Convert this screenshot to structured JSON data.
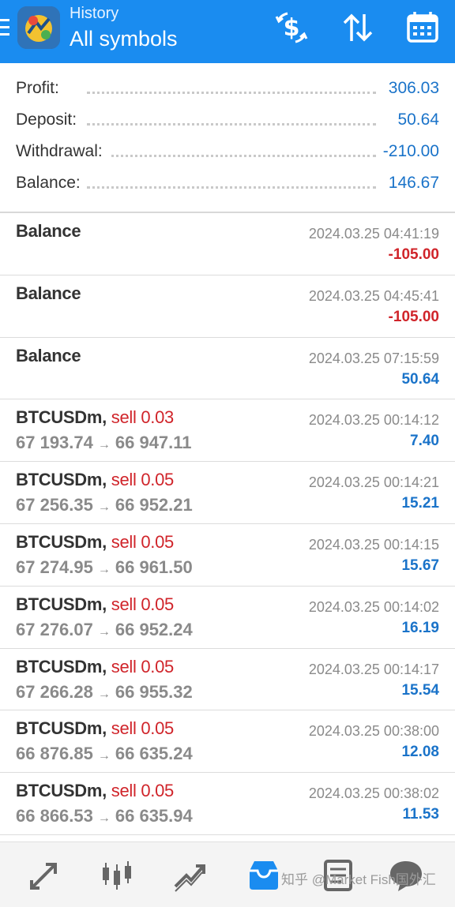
{
  "header": {
    "subtitle": "History",
    "title": "All symbols"
  },
  "summary": [
    {
      "label": "Profit:",
      "value": "306.03"
    },
    {
      "label": "Deposit:",
      "value": "50.64"
    },
    {
      "label": "Withdrawal:",
      "value": "-210.00"
    },
    {
      "label": "Balance:",
      "value": "146.67"
    }
  ],
  "items": [
    {
      "type": "balance",
      "title": "Balance",
      "date": "2024.03.25 04:41:19",
      "amount": "-105.00",
      "sign": "neg"
    },
    {
      "type": "balance",
      "title": "Balance",
      "date": "2024.03.25 04:45:41",
      "amount": "-105.00",
      "sign": "neg"
    },
    {
      "type": "balance",
      "title": "Balance",
      "date": "2024.03.25 07:15:59",
      "amount": "50.64",
      "sign": "pos"
    },
    {
      "type": "trade",
      "symbol": "BTCUSDm,",
      "side": "sell 0.03",
      "open": "67 193.74",
      "close": "66 947.11",
      "date": "2024.03.25 00:14:12",
      "amount": "7.40",
      "sign": "pos"
    },
    {
      "type": "trade",
      "symbol": "BTCUSDm,",
      "side": "sell 0.05",
      "open": "67 256.35",
      "close": "66 952.21",
      "date": "2024.03.25 00:14:21",
      "amount": "15.21",
      "sign": "pos"
    },
    {
      "type": "trade",
      "symbol": "BTCUSDm,",
      "side": "sell 0.05",
      "open": "67 274.95",
      "close": "66 961.50",
      "date": "2024.03.25 00:14:15",
      "amount": "15.67",
      "sign": "pos"
    },
    {
      "type": "trade",
      "symbol": "BTCUSDm,",
      "side": "sell 0.05",
      "open": "67 276.07",
      "close": "66 952.24",
      "date": "2024.03.25 00:14:02",
      "amount": "16.19",
      "sign": "pos"
    },
    {
      "type": "trade",
      "symbol": "BTCUSDm,",
      "side": "sell 0.05",
      "open": "67 266.28",
      "close": "66 955.32",
      "date": "2024.03.25 00:14:17",
      "amount": "15.54",
      "sign": "pos"
    },
    {
      "type": "trade",
      "symbol": "BTCUSDm,",
      "side": "sell 0.05",
      "open": "66 876.85",
      "close": "66 635.24",
      "date": "2024.03.25 00:38:00",
      "amount": "12.08",
      "sign": "pos"
    },
    {
      "type": "trade",
      "symbol": "BTCUSDm,",
      "side": "sell 0.05",
      "open": "66 866.53",
      "close": "66 635.94",
      "date": "2024.03.25 00:38:02",
      "amount": "11.53",
      "sign": "pos"
    }
  ],
  "arrow_glyph": "→",
  "colors": {
    "header": "#1a8cf0",
    "profit": "#1a73c9",
    "loss": "#d0242a",
    "active_tab": "#1a8cf0"
  },
  "icons": {
    "header": [
      "currency-exchange-icon",
      "sort-icon",
      "calendar-icon"
    ],
    "nav": [
      "quotes-icon",
      "chart-icon",
      "trade-icon",
      "history-icon",
      "news-icon",
      "messages-icon"
    ]
  },
  "watermark": "知乎 @Market Fish国外汇"
}
